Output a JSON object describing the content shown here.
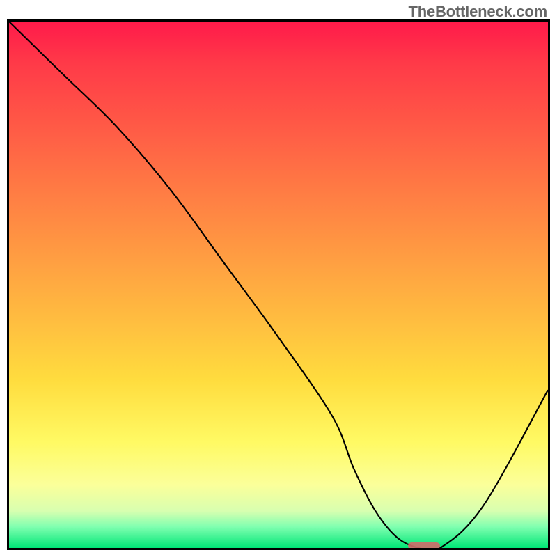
{
  "attribution": {
    "label": "TheBottleneck.com"
  },
  "chart_data": {
    "type": "line",
    "title": "",
    "xlabel": "",
    "ylabel": "",
    "xlim": [
      0,
      100
    ],
    "ylim": [
      0,
      100
    ],
    "series": [
      {
        "name": "curve",
        "x": [
          0,
          10,
          20,
          30,
          40,
          50,
          60,
          64,
          68,
          72,
          76,
          80,
          88,
          100
        ],
        "y": [
          100,
          90,
          80,
          68,
          54,
          40,
          25,
          15,
          7,
          2,
          0,
          0,
          8,
          30
        ]
      }
    ],
    "marker": {
      "x_start": 74,
      "x_end": 80,
      "y": 0
    }
  }
}
